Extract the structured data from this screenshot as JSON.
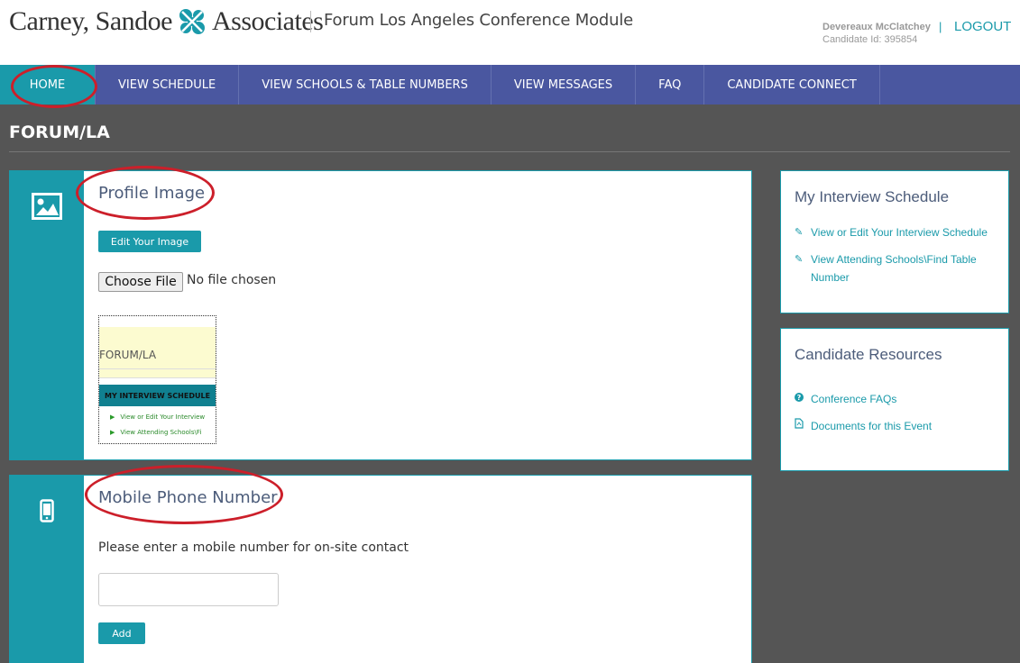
{
  "header": {
    "logo_left": "Carney, Sandoe",
    "logo_right": "Associates",
    "logo_mark": "logo-mark-icon",
    "module_title": "Forum Los Angeles Conference Module",
    "user_name": "Devereaux McClatchey",
    "candidate_id": "Candidate Id: 395854",
    "separator": "|",
    "logout_label": "LOGOUT"
  },
  "nav": {
    "items": [
      {
        "label": "HOME",
        "active": true
      },
      {
        "label": "VIEW SCHEDULE"
      },
      {
        "label": "VIEW SCHOOLS & TABLE NUMBERS"
      },
      {
        "label": "VIEW MESSAGES"
      },
      {
        "label": "FAQ"
      },
      {
        "label": "CANDIDATE CONNECT"
      }
    ]
  },
  "page": {
    "title": "FORUM/LA"
  },
  "profile_card": {
    "icon": "image-icon",
    "title": "Profile Image",
    "edit_button": "Edit Your Image",
    "choose_file": "Choose File",
    "no_file": "No file chosen",
    "thumbnail": {
      "forum_text": "FORUM/LA",
      "bar_text": "MY INTERVIEW SCHEDULE",
      "item1": "View or Edit Your Interview",
      "item2": "View Attending Schools\\Fi"
    }
  },
  "phone_card": {
    "icon": "mobile-phone-icon",
    "title": "Mobile Phone Number",
    "prompt": "Please enter a mobile number for on-site contact",
    "input_value": "",
    "add_button": "Add"
  },
  "sidebar": {
    "schedule": {
      "title": "My Interview Schedule",
      "links": [
        {
          "icon": "edit-icon",
          "label": "View or Edit Your Interview Schedule"
        },
        {
          "icon": "edit-icon",
          "label": "View Attending Schools\\Find Table Number"
        }
      ]
    },
    "resources": {
      "title": "Candidate Resources",
      "links": [
        {
          "icon": "question-circle-icon",
          "label": "Conference FAQs"
        },
        {
          "icon": "pdf-file-icon",
          "label": "Documents for this Event"
        }
      ]
    }
  },
  "colors": {
    "accent": "#1a9aaa",
    "nav": "#4a57a0",
    "background": "#555555",
    "annotation": "#cc1f2a"
  }
}
